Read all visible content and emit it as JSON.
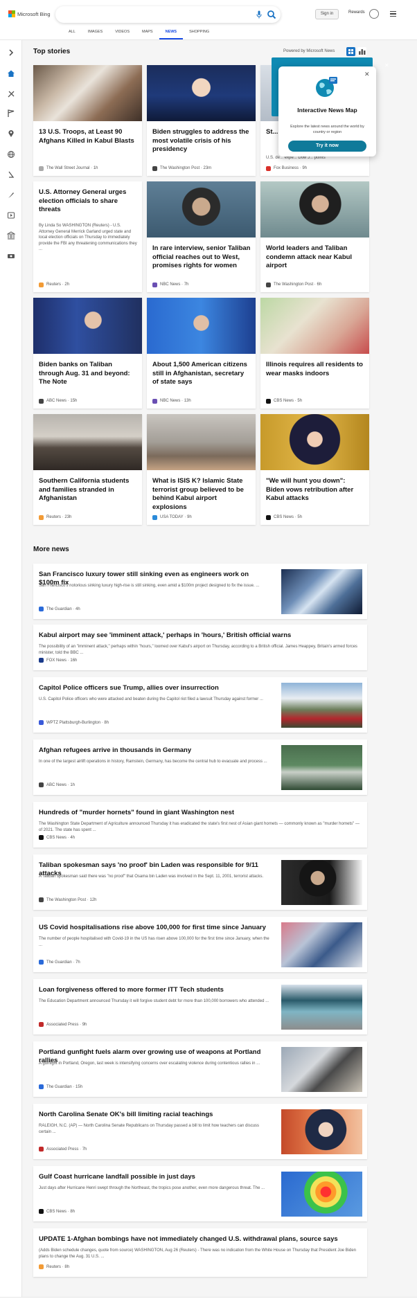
{
  "header": {
    "logo_text": "Microsoft Bing",
    "search_value": "",
    "signin": "Sign in",
    "rewards": "Rewards",
    "tabs": [
      "ALL",
      "IMAGES",
      "VIDEOS",
      "MAPS",
      "NEWS",
      "SHOPPING"
    ],
    "active_tab": "NEWS"
  },
  "top_stories": {
    "heading": "Top stories",
    "powered_by": "Powered by Microsoft News",
    "cards": [
      {
        "title": "13 U.S. Troops, at Least 90 Afghans Killed in Kabul Blasts",
        "snippet": "",
        "source": "The Wall Street Journal",
        "age": "1h"
      },
      {
        "title": "Biden struggles to address the most volatile crisis of his presidency",
        "snippet": "",
        "source": "The Washington Post",
        "age": "23m"
      },
      {
        "title": "St... ch...",
        "snippet": "U.S. de... expe... Dow J... points",
        "source": "Fox Business",
        "age": "9h"
      },
      {
        "title": "U.S. Attorney General urges election officials to share threats",
        "snippet": "By Linda So WASHINGTON (Reuters) - U.S. Attorney General Merrick Garland urged state and local election officials on Thursday to immediately provide the FBI any threatening communications they ...",
        "source": "Reuters",
        "age": "2h"
      },
      {
        "title": "In rare interview, senior Taliban official reaches out to West, promises rights for women",
        "snippet": "",
        "source": "NBC News",
        "age": "7h"
      },
      {
        "title": "World leaders and Taliban condemn attack near Kabul airport",
        "snippet": "",
        "source": "The Washington Post",
        "age": "6h"
      },
      {
        "title": "Biden banks on Taliban through Aug. 31 and beyond: The Note",
        "snippet": "",
        "source": "ABC News",
        "age": "15h"
      },
      {
        "title": "About 1,500 American citizens still in Afghanistan, secretary of state says",
        "snippet": "",
        "source": "NBC News",
        "age": "13h"
      },
      {
        "title": "Illinois requires all residents to wear masks indoors",
        "snippet": "",
        "source": "CBS News",
        "age": "5h"
      },
      {
        "title": "Southern California students and families stranded in Afghanistan",
        "snippet": "",
        "source": "Reuters",
        "age": "23h"
      },
      {
        "title": "What is ISIS K? Islamic State terrorist group believed to be behind Kabul airport explosions",
        "snippet": "",
        "source": "USA TODAY",
        "age": "9h"
      },
      {
        "title": "\"We will hunt you down\": Biden vows retribution after Kabul attacks",
        "snippet": "",
        "source": "CBS News",
        "age": "5h"
      }
    ]
  },
  "promo": {
    "title": "Interactive News Map",
    "desc": "Explore the latest news around the world by country or region",
    "button": "Try it now"
  },
  "more_news": {
    "heading": "More news",
    "items": [
      {
        "title": "San Francisco luxury tower still sinking even as engineers work on $100m fix",
        "snippet": "San Francisco's notorious sinking luxury high-rise is still sinking, even amid a $100m project designed to fix the issue. ...",
        "source": "The Guardian",
        "age": "4h"
      },
      {
        "title": "Kabul airport may see 'imminent attack,' perhaps in 'hours,' British official warns",
        "snippet": "The possibility of an \"imminent attack,\" perhaps within \"hours,\" loomed over Kabul's airport on Thursday, according to a British official. James Heappey, Britain's armed forces minister, told the BBC ...",
        "source": "FOX News",
        "age": "16h"
      },
      {
        "title": "Capitol Police officers sue Trump, allies over insurrection",
        "snippet": "U.S. Capitol Police officers who were attacked and beaten during the Capitol riot filed a lawsuit Thursday against former ...",
        "source": "WPTZ Plattsburgh-Burlington",
        "age": "8h"
      },
      {
        "title": "Afghan refugees arrive in thousands in Germany",
        "snippet": "In one of the largest airlift operations in history, Ramstein, Germany, has become the central hub to evacuate and process ...",
        "source": "ABC News",
        "age": "1h"
      },
      {
        "title": "Hundreds of \"murder hornets\" found in giant Washington nest",
        "snippet": "The Washington State Department of Agriculture announced Thursday it has eradicated the state's first nest of Asian giant hornets — commonly known as \"murder hornets\" — of 2021. The state has spent ...",
        "source": "CBS News",
        "age": "4h"
      },
      {
        "title": "Taliban spokesman says 'no proof' bin Laden was responsible for 9/11 attacks",
        "snippet": "A Taliban spokesman said there was \"no proof\" that Osama bin Laden was involved in the Sept. 11, 2001, terrorist attacks.",
        "source": "The Washington Post",
        "age": "12h"
      },
      {
        "title": "US Covid hospitalisations rise above 100,000 for first time since January",
        "snippet": "The number of people hospitalised with Covid-19 in the US has risen above 100,000 for the first time since January, when the ...",
        "source": "The Guardian",
        "age": "7h"
      },
      {
        "title": "Loan forgiveness offered to more former ITT Tech students",
        "snippet": "The Education Department announced Thursday it will forgive student debt for more than 100,000 borrowers who attended ...",
        "source": "Associated Press",
        "age": "9h"
      },
      {
        "title": "Portland gunfight fuels alarm over growing use of weapons at Portland rallies",
        "snippet": "A gunfight in Portland, Oregon, last week is intensifying concerns over escalating violence during contentious rallies in ...",
        "source": "The Guardian",
        "age": "15h"
      },
      {
        "title": "North Carolina Senate OK's bill limiting racial teachings",
        "snippet": "RALEIGH, N.C. (AP) — North Carolina Senate Republicans on Thursday passed a bill to limit how teachers can discuss certain ...",
        "source": "Associated Press",
        "age": "7h"
      },
      {
        "title": "Gulf Coast hurricane landfall possible in just days",
        "snippet": "Just days after Hurricane Henri swept through the Northeast, the tropics pose another, even more dangerous threat. The ...",
        "source": "CBS News",
        "age": "8h"
      },
      {
        "title": "UPDATE 1-Afghan bombings have not immediately changed U.S. withdrawal plans, source says",
        "snippet": "(Adds Biden schedule changes, quote from source) WASHINGTON, Aug 26 (Reuters) - There was no indication from the White House on Thursday that President Joe Biden plans to change the Aug. 31 U.S. ...",
        "source": "Reuters",
        "age": "8h"
      }
    ]
  },
  "colors": {
    "accent": "#174ae4",
    "promo": "#0f7a9a"
  }
}
